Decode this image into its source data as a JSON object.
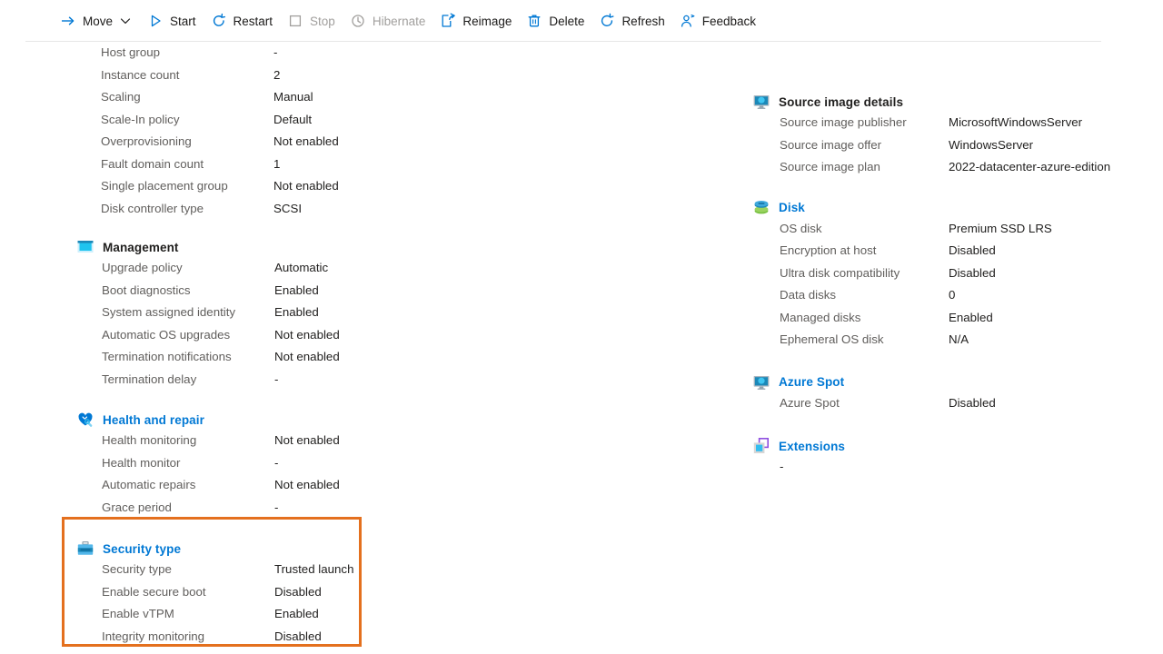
{
  "toolbar": {
    "items": [
      {
        "label": "Move",
        "icon": "move-arrow-icon",
        "disabled": false,
        "has_caret": true
      },
      {
        "label": "Start",
        "icon": "play-icon",
        "disabled": false,
        "has_caret": false
      },
      {
        "label": "Restart",
        "icon": "restart-icon",
        "disabled": false,
        "has_caret": false
      },
      {
        "label": "Stop",
        "icon": "stop-square-icon",
        "disabled": true,
        "has_caret": false
      },
      {
        "label": "Hibernate",
        "icon": "clock-icon",
        "disabled": true,
        "has_caret": false
      },
      {
        "label": "Reimage",
        "icon": "reimage-icon",
        "disabled": false,
        "has_caret": false
      },
      {
        "label": "Delete",
        "icon": "trash-icon",
        "disabled": false,
        "has_caret": false
      },
      {
        "label": "Refresh",
        "icon": "refresh-icon",
        "disabled": false,
        "has_caret": false
      },
      {
        "label": "Feedback",
        "icon": "feedback-icon",
        "disabled": false,
        "has_caret": false
      }
    ]
  },
  "colors": {
    "accent_blue": "#0078d4",
    "highlight_orange": "#e4701e",
    "label_gray": "#605e5c",
    "value_dark": "#201f1e",
    "disabled_gray": "#a19f9d"
  },
  "left_column": {
    "scale_set_rows": [
      {
        "key": "Host group",
        "value": "-"
      },
      {
        "key": "Instance count",
        "value": "2"
      },
      {
        "key": "Scaling",
        "value": "Manual"
      },
      {
        "key": "Scale-In policy",
        "value": "Default"
      },
      {
        "key": "Overprovisioning",
        "value": "Not enabled"
      },
      {
        "key": "Fault domain count",
        "value": "1"
      },
      {
        "key": "Single placement group",
        "value": "Not enabled"
      },
      {
        "key": "Disk controller type",
        "value": "SCSI"
      }
    ],
    "management": {
      "title": "Management",
      "icon": "management-window-icon",
      "title_style": "dark",
      "rows": [
        {
          "key": "Upgrade policy",
          "value": "Automatic"
        },
        {
          "key": "Boot diagnostics",
          "value": "Enabled"
        },
        {
          "key": "System assigned identity",
          "value": "Enabled"
        },
        {
          "key": "Automatic OS upgrades",
          "value": "Not enabled"
        },
        {
          "key": "Termination notifications",
          "value": "Not enabled"
        },
        {
          "key": "Termination delay",
          "value": "-"
        }
      ]
    },
    "health_and_repair": {
      "title": "Health and repair",
      "icon": "heart-wrench-icon",
      "title_style": "blue",
      "rows": [
        {
          "key": "Health monitoring",
          "value": "Not enabled"
        },
        {
          "key": "Health monitor",
          "value": "-"
        },
        {
          "key": "Automatic repairs",
          "value": "Not enabled"
        },
        {
          "key": "Grace period",
          "value": "-"
        }
      ]
    },
    "security_type": {
      "title": "Security type",
      "icon": "toolbox-icon",
      "title_style": "blue",
      "highlighted": true,
      "rows": [
        {
          "key": "Security type",
          "value": "Trusted launch"
        },
        {
          "key": "Enable secure boot",
          "value": "Disabled"
        },
        {
          "key": "Enable vTPM",
          "value": "Enabled"
        },
        {
          "key": "Integrity monitoring",
          "value": "Disabled"
        }
      ]
    }
  },
  "right_column": {
    "source_image_details": {
      "title": "Source image details",
      "icon": "monitor-icon",
      "title_style": "dark",
      "rows": [
        {
          "key": "Source image publisher",
          "value": "MicrosoftWindowsServer"
        },
        {
          "key": "Source image offer",
          "value": "WindowsServer"
        },
        {
          "key": "Source image plan",
          "value": "2022-datacenter-azure-edition"
        }
      ]
    },
    "disk": {
      "title": "Disk",
      "icon": "disk-stack-icon",
      "title_style": "blue",
      "rows": [
        {
          "key": "OS disk",
          "value": "Premium SSD LRS"
        },
        {
          "key": "Encryption at host",
          "value": "Disabled"
        },
        {
          "key": "Ultra disk compatibility",
          "value": "Disabled"
        },
        {
          "key": "Data disks",
          "value": "0"
        },
        {
          "key": "Managed disks",
          "value": "Enabled"
        },
        {
          "key": "Ephemeral OS disk",
          "value": "N/A"
        }
      ]
    },
    "azure_spot": {
      "title": "Azure Spot",
      "icon": "monitor-icon",
      "title_style": "blue",
      "rows": [
        {
          "key": "Azure Spot",
          "value": "Disabled"
        }
      ]
    },
    "extensions": {
      "title": "Extensions",
      "icon": "extensions-icon",
      "title_style": "blue",
      "empty_value": "-"
    }
  }
}
